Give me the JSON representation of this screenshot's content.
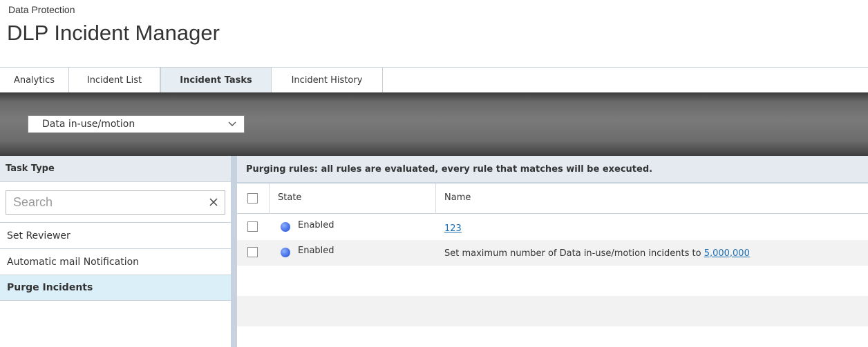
{
  "header": {
    "breadcrumb": "Data Protection",
    "title": "DLP Incident Manager"
  },
  "tabs": [
    {
      "label": "Analytics",
      "active": false
    },
    {
      "label": "Incident List",
      "active": false
    },
    {
      "label": "Incident Tasks",
      "active": true
    },
    {
      "label": "Incident History",
      "active": false
    }
  ],
  "toolbar": {
    "data_type_select": "Data in-use/motion"
  },
  "left_panel": {
    "header": "Task Type",
    "search": {
      "placeholder": "Search",
      "value": ""
    },
    "items": [
      {
        "label": "Set Reviewer",
        "selected": false
      },
      {
        "label": "Automatic mail Notification",
        "selected": false
      },
      {
        "label": "Purge Incidents",
        "selected": true
      }
    ]
  },
  "right_panel": {
    "header": "Purging rules: all rules are evaluated, every rule that matches will be executed.",
    "columns": {
      "state": "State",
      "name": "Name"
    },
    "rows": [
      {
        "state": "Enabled",
        "name_prefix": "",
        "name_link": "123"
      },
      {
        "state": "Enabled",
        "name_prefix": "Set maximum number of Data in-use/motion incidents to ",
        "name_link": "5,000,000"
      }
    ]
  },
  "colors": {
    "accent_link": "#1a6db3",
    "selected_row": "#dbeff9",
    "header_bg": "#e4eaf0",
    "status_enabled": "#4a74e8"
  }
}
